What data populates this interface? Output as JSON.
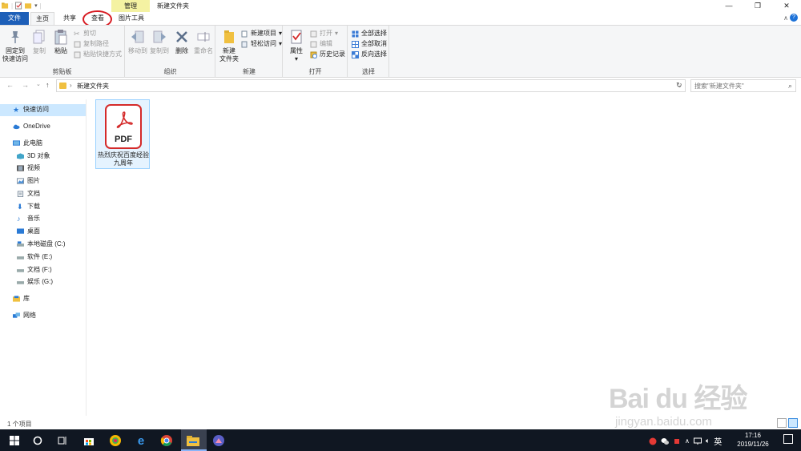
{
  "titlebar": {
    "context_tab": "管理",
    "window_title": "新建文件夹",
    "minimize": "—",
    "maximize": "❐",
    "close": "✕"
  },
  "tabs": {
    "file": "文件",
    "home": "主页",
    "share": "共享",
    "view": "查看",
    "picture_tools": "图片工具"
  },
  "ribbon": {
    "clipboard": {
      "label": "剪贴板",
      "pin": [
        "固定到",
        "快速访问"
      ],
      "copy": "复制",
      "paste": "粘贴",
      "cut": "剪切",
      "copy_path": "复制路径",
      "paste_shortcut": "粘贴快捷方式"
    },
    "organize": {
      "label": "组织",
      "move_to": "移动到",
      "copy_to": "复制到",
      "delete": "删除",
      "rename": "重命名"
    },
    "new": {
      "label": "新建",
      "new_folder": [
        "新建",
        "文件夹"
      ],
      "new_item": "新建项目",
      "easy_access": "轻松访问"
    },
    "open": {
      "label": "打开",
      "properties": "属性",
      "open": "打开",
      "edit": "编辑",
      "history": "历史记录"
    },
    "select": {
      "label": "选择",
      "select_all": "全部选择",
      "select_none": "全部取消",
      "invert": "反向选择"
    }
  },
  "address": {
    "path": "新建文件夹",
    "search_placeholder": "搜索\"新建文件夹\""
  },
  "navpane": {
    "quick_access": "快速访问",
    "onedrive": "OneDrive",
    "this_pc": "此电脑",
    "items": [
      "3D 对象",
      "视频",
      "图片",
      "文档",
      "下载",
      "音乐",
      "桌面",
      "本地磁盘 (C:)",
      "软件 (E:)",
      "文档 (F:)",
      "娱乐 (G:)"
    ],
    "library": "库",
    "network": "网络"
  },
  "content": {
    "file_icon_text": "PDF",
    "file_name": "热烈庆祝百度经验九周年"
  },
  "status": {
    "count": "1 个项目"
  },
  "watermark": {
    "main": "Bai du 经验",
    "sub": "jingyan.baidu.com"
  },
  "taskbar": {
    "time": "17:16",
    "date": "2019/11/26",
    "ime": "英"
  },
  "colors": {
    "file_tab": "#1d5fb8",
    "context_tab": "#f4f2a2",
    "selection": "#cce8ff",
    "pdf_red": "#d42a2a",
    "highlight_circle": "#d71920",
    "taskbar": "#101722"
  }
}
